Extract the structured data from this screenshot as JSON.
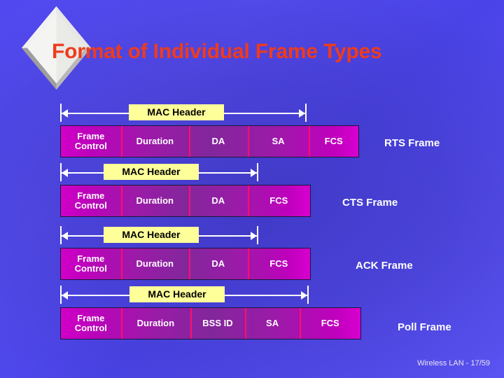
{
  "title": {
    "text": "Format of Individual Frame Types",
    "color": "#ef3b1c",
    "bullet_icon": "diamond-bullet-icon"
  },
  "mac_header_label": "MAC Header",
  "rows": [
    {
      "name": "RTS Frame",
      "mac_header_label": "MAC Header",
      "segments": [
        "Frame\nControl",
        "Duration",
        "DA",
        "SA",
        "FCS"
      ]
    },
    {
      "name": "CTS Frame",
      "mac_header_label": "MAC Header",
      "segments": [
        "Frame\nControl",
        "Duration",
        "DA",
        "FCS"
      ]
    },
    {
      "name": "ACK Frame",
      "mac_header_label": "MAC Header",
      "segments": [
        "Frame\nControl",
        "Duration",
        "DA",
        "FCS"
      ]
    },
    {
      "name": "Poll Frame",
      "mac_header_label": "MAC Header",
      "segments": [
        "Frame\nControl",
        "Duration",
        "BSS ID",
        "SA",
        "FCS"
      ]
    }
  ],
  "footer": "Wireless LAN - 17/59",
  "colors": {
    "background_blue": "#5149ef",
    "background_blue_deep": "#4a43e8",
    "title_red": "#ef3b1c",
    "label_yellow": "#ffff99",
    "bar_magenta": "#d100c8",
    "bar_purple": "#82279b",
    "divider_pink": "#ff0f6b",
    "text_white": "#ffffff"
  }
}
